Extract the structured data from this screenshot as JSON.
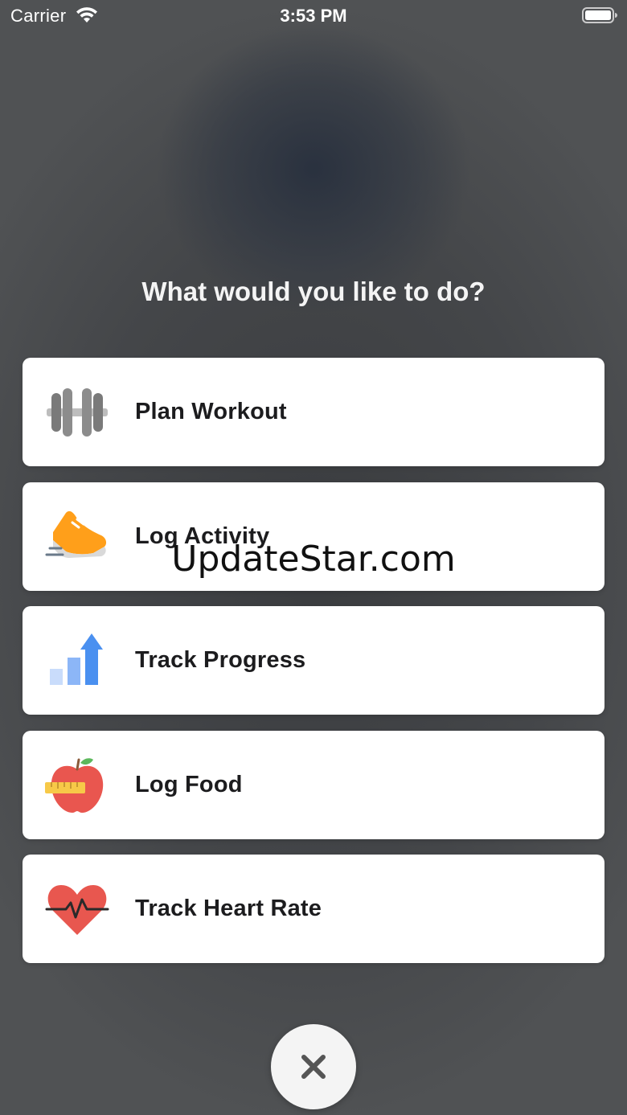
{
  "status_bar": {
    "carrier": "Carrier",
    "time": "3:53 PM",
    "wifi_icon": "wifi-icon",
    "battery_icon": "battery-full-icon"
  },
  "prompt": "What would you like to do?",
  "menu": {
    "items": [
      {
        "label": "Plan Workout",
        "icon": "dumbbell-icon"
      },
      {
        "label": "Log Activity",
        "icon": "running-shoe-icon"
      },
      {
        "label": "Track Progress",
        "icon": "bar-chart-arrow-icon"
      },
      {
        "label": "Log Food",
        "icon": "apple-measuring-tape-icon"
      },
      {
        "label": "Track Heart Rate",
        "icon": "heart-rate-icon"
      }
    ]
  },
  "watermark": "UpdateStar.com",
  "close_button": {
    "icon": "close-icon"
  },
  "colors": {
    "card_background": "#ffffff",
    "label_text": "#1c1c1e",
    "overlay": "#4a4c4e",
    "shoe_orange": "#ff9f1a",
    "chart_blue": "#4a90f0",
    "apple_red": "#e9564f",
    "tape_yellow": "#f7c948",
    "heart_red": "#e8574f",
    "dumbbell_gray": "#7a7a7a"
  }
}
